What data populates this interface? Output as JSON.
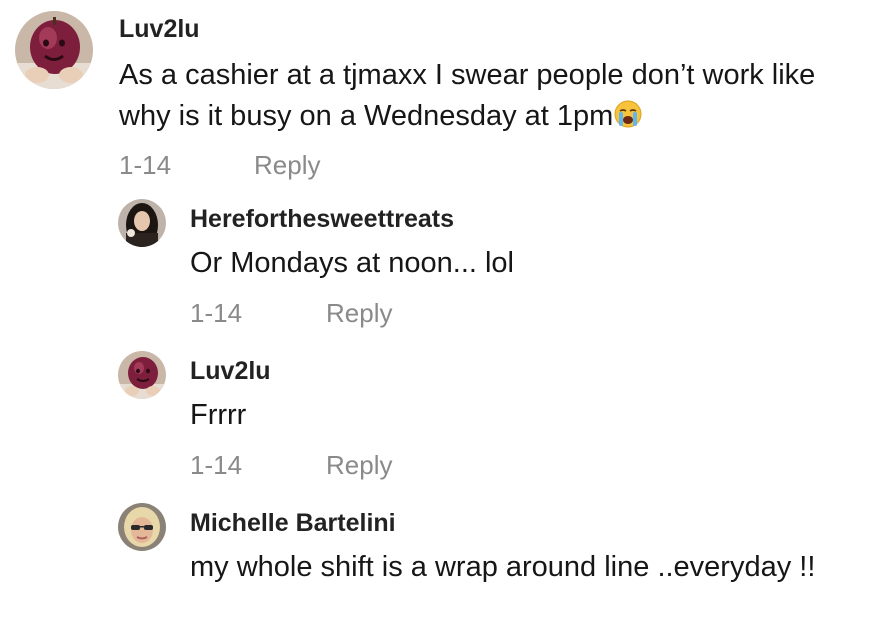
{
  "comments": [
    {
      "username": "Luv2lu",
      "text": "As a cashier at a tjmaxx I swear people don’t work like why is it busy on a Wednesday at 1pm",
      "emoji": "loudly-crying-face-emoji",
      "date": "1-14",
      "reply_label": "Reply",
      "avatar": "apple-face-avatar-icon"
    },
    {
      "username": "Hereforthesweettreats",
      "text": "Or Mondays at noon... lol",
      "date": "1-14",
      "reply_label": "Reply",
      "avatar": "woman-dark-hair-avatar-icon"
    },
    {
      "username": "Luv2lu",
      "text": "Frrrr",
      "date": "1-14",
      "reply_label": "Reply",
      "avatar": "apple-face-avatar-icon"
    },
    {
      "username": "Michelle Bartelini",
      "text": "my whole shift is a wrap around line ..everyday !!",
      "avatar": "woman-blonde-sunglasses-avatar-icon"
    }
  ],
  "colors": {
    "username": "#222222",
    "text": "#161616",
    "meta": "#8a8a8a",
    "background": "#ffffff"
  }
}
